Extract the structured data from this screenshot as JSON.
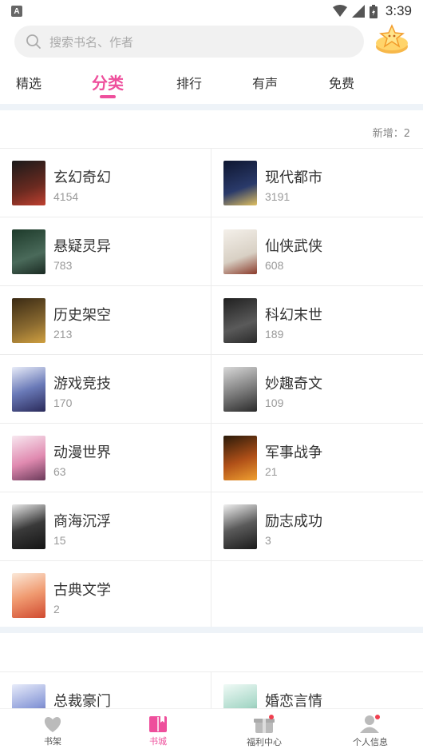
{
  "status_bar": {
    "time": "3:39",
    "app_badge": "A"
  },
  "search": {
    "placeholder": "搜索书名、作者"
  },
  "tabs": [
    {
      "label": "精选",
      "active": false
    },
    {
      "label": "分类",
      "active": true
    },
    {
      "label": "排行",
      "active": false
    },
    {
      "label": "有声",
      "active": false
    },
    {
      "label": "免费",
      "active": false
    }
  ],
  "section1": {
    "new_label": "新增：2"
  },
  "categories": [
    {
      "name": "玄幻奇幻",
      "count": "4154",
      "cover_color": "#5a2a20"
    },
    {
      "name": "现代都市",
      "count": "3191",
      "cover_color": "#1d2a4a"
    },
    {
      "name": "悬疑灵异",
      "count": "783",
      "cover_color": "#2e4a3a"
    },
    {
      "name": "仙侠武侠",
      "count": "608",
      "cover_color": "#e9e4dc"
    },
    {
      "name": "历史架空",
      "count": "213",
      "cover_color": "#6a4a22"
    },
    {
      "name": "科幻末世",
      "count": "189",
      "cover_color": "#3a3a3a"
    },
    {
      "name": "游戏竞技",
      "count": "170",
      "cover_color": "#3a4a8a"
    },
    {
      "name": "妙趣奇文",
      "count": "109",
      "cover_color": "#555555"
    },
    {
      "name": "动漫世界",
      "count": "63",
      "cover_color": "#d88aa8"
    },
    {
      "name": "军事战争",
      "count": "21",
      "cover_color": "#a04818"
    },
    {
      "name": "商海沉浮",
      "count": "15",
      "cover_color": "#2a2a2a"
    },
    {
      "name": "励志成功",
      "count": "3",
      "cover_color": "#4a4a4a"
    },
    {
      "name": "古典文学",
      "count": "2",
      "cover_color": "#e87a5a"
    }
  ],
  "section2": [
    {
      "name": "总裁豪门",
      "cover_color": "#7a8ad0"
    },
    {
      "name": "婚恋言情",
      "cover_color": "#a8d8c8"
    }
  ],
  "bottom_nav": [
    {
      "label": "书架",
      "icon": "heart-icon",
      "active": false
    },
    {
      "label": "书城",
      "icon": "book-icon",
      "active": true
    },
    {
      "label": "福利中心",
      "icon": "gift-box-icon",
      "active": false
    },
    {
      "label": "个人信息",
      "icon": "person-icon",
      "active": false
    }
  ],
  "colors": {
    "accent": "#ee4f9c",
    "band": "#eef3f8"
  }
}
